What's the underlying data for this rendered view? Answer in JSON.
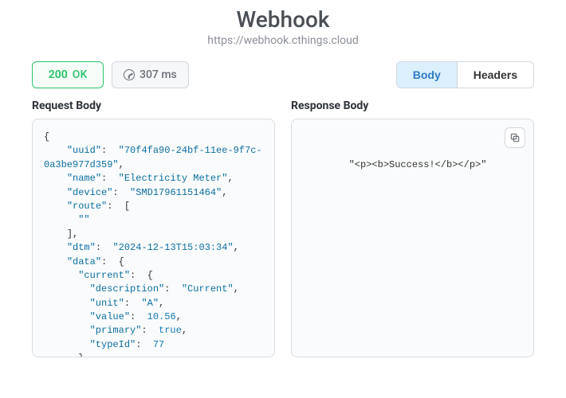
{
  "title": "Webhook",
  "url": "https://webhook.cthings.cloud",
  "status": {
    "code": "200",
    "text": "OK"
  },
  "latency": "307 ms",
  "tabs": {
    "body": "Body",
    "headers": "Headers",
    "active": "body"
  },
  "sections": {
    "request": "Request Body",
    "response": "Response Body"
  },
  "request": {
    "uuid": "70f4fa90-24bf-11ee-9f7c-0a3be977d359",
    "name": "Electricity Meter",
    "device": "SMD17961151464",
    "route": [
      ""
    ],
    "dtm": "2024-12-13T15:03:34",
    "data": {
      "current": {
        "description": "Current",
        "unit": "A",
        "value": 10.56,
        "primary": true,
        "typeId": 77
      }
    }
  },
  "response_raw": "\"<p><b>Success!</b></p>\""
}
